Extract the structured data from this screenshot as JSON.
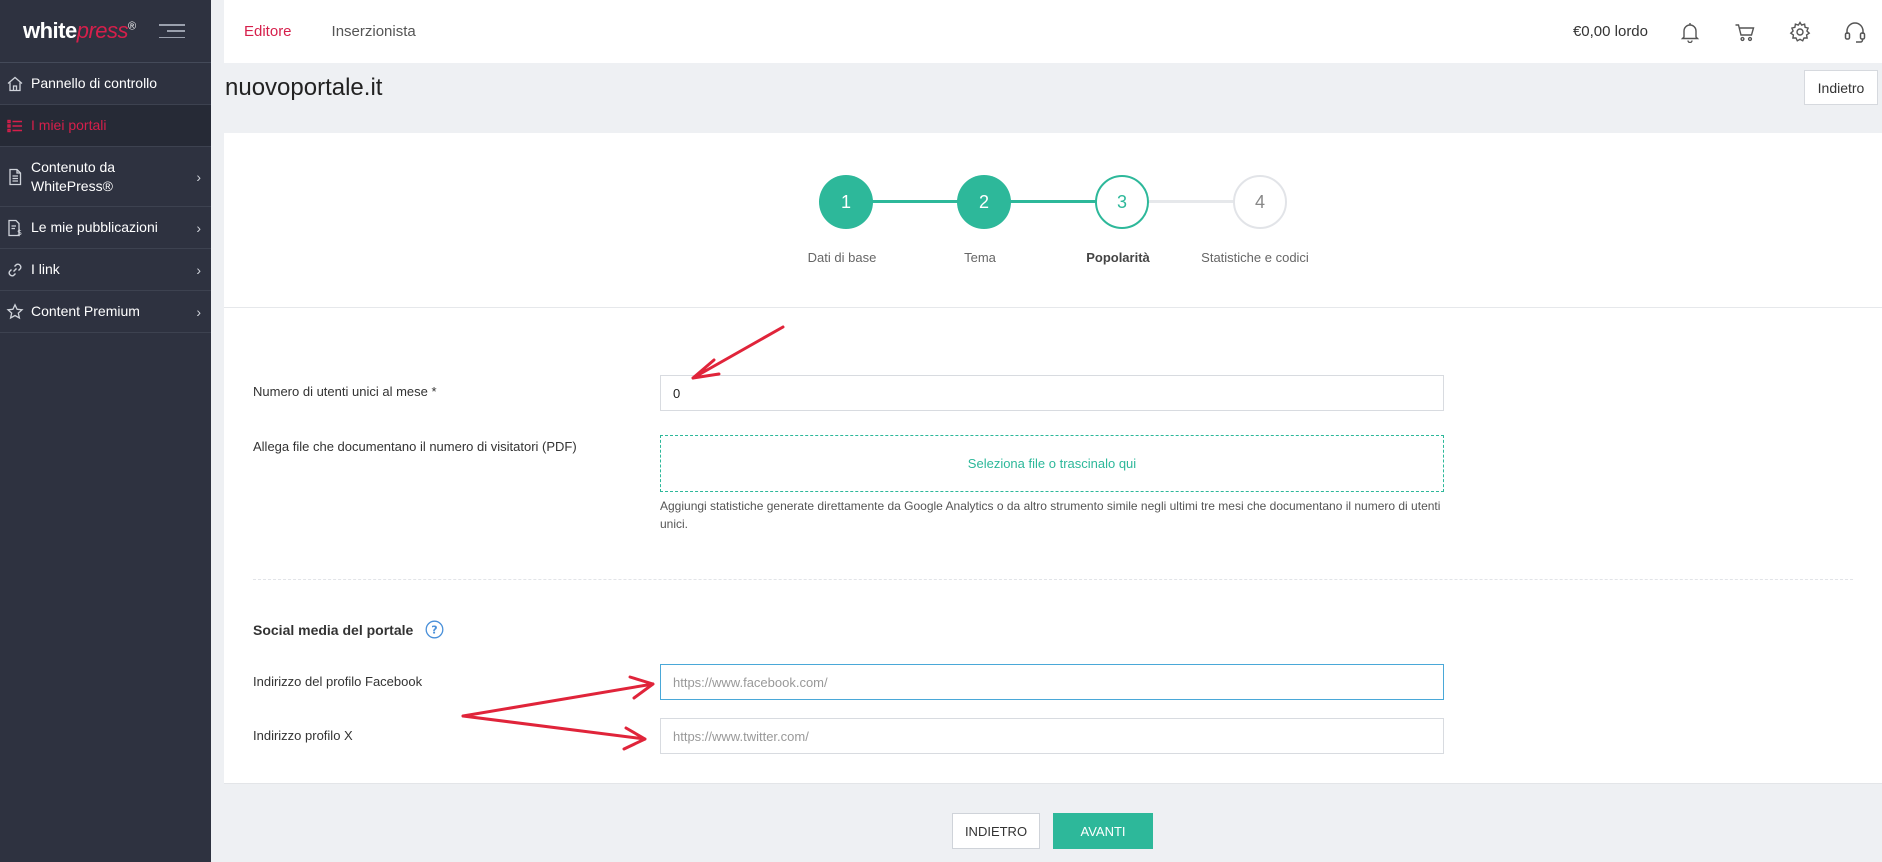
{
  "brand": {
    "logo_white": "white",
    "logo_red": "press",
    "logo_mark": "®"
  },
  "sidebar": {
    "items": [
      {
        "label": "Pannello di controllo",
        "icon": "home-icon",
        "active": false,
        "has_chevron": false
      },
      {
        "label": "I miei portali",
        "icon": "list-icon",
        "active": true,
        "has_chevron": false
      },
      {
        "label": "Contenuto da WhitePress®",
        "icon": "document-icon",
        "active": false,
        "has_chevron": true
      },
      {
        "label": "Le mie pubblicazioni",
        "icon": "invoice-icon",
        "active": false,
        "has_chevron": true
      },
      {
        "label": "I link",
        "icon": "link-icon",
        "active": false,
        "has_chevron": true
      },
      {
        "label": "Content Premium",
        "icon": "star-icon",
        "active": false,
        "has_chevron": true
      }
    ]
  },
  "topbar": {
    "tabs": [
      {
        "label": "Editore",
        "active": true
      },
      {
        "label": "Inserzionista",
        "active": false
      }
    ],
    "balance": "€0,00 lordo",
    "icons": [
      "bell-icon",
      "cart-icon",
      "gear-icon",
      "headset-icon"
    ]
  },
  "header": {
    "title": "nuovoportale.it",
    "back_label": "Indietro"
  },
  "stepper": {
    "steps": [
      {
        "number": "1",
        "label": "Dati di base",
        "state": "done"
      },
      {
        "number": "2",
        "label": "Tema",
        "state": "done"
      },
      {
        "number": "3",
        "label": "Popolarità",
        "state": "current"
      },
      {
        "number": "4",
        "label": "Statistiche e codici",
        "state": "todo"
      }
    ]
  },
  "form": {
    "monthly_users": {
      "label": "Numero di utenti unici al mese *",
      "value": "0"
    },
    "attachment": {
      "label": "Allega file che documentano il numero di visitatori (PDF)",
      "dropzone_text": "Seleziona file o trascinalo qui",
      "hint": "Aggiungi statistiche generate direttamente da Google Analytics o da altro strumento simile negli ultimi tre mesi che documentano il numero di utenti unici."
    },
    "social_title": "Social media del portale",
    "facebook": {
      "label": "Indirizzo del profilo Facebook",
      "placeholder": "https://www.facebook.com/",
      "value": ""
    },
    "x_profile": {
      "label": "Indirizzo profilo X",
      "placeholder": "https://www.twitter.com/",
      "value": ""
    }
  },
  "footer": {
    "back_label": "INDIETRO",
    "next_label": "AVANTI"
  },
  "colors": {
    "accent_green": "#2db89a",
    "brand_red": "#d61f4b",
    "sidebar_bg": "#2e3240",
    "annotation_red": "#e0243a"
  }
}
